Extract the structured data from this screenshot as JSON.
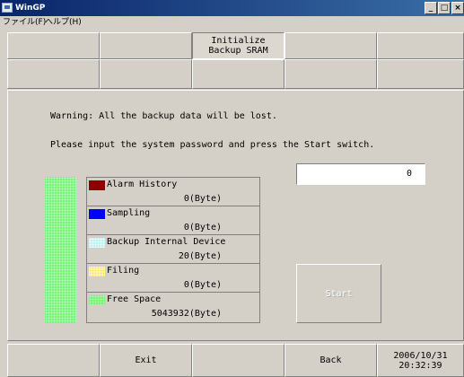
{
  "window": {
    "title": "WinGP",
    "controls": [
      "_",
      "□",
      "×"
    ]
  },
  "menu": {
    "items": [
      "ファイル(F)",
      "ヘルプ(H)"
    ]
  },
  "toolbar": {
    "row1": [
      "",
      "Initialize\nBackup SRAM",
      "",
      "",
      ""
    ],
    "row2": [
      "",
      "",
      "",
      "",
      ""
    ]
  },
  "messages": {
    "warning": "Warning: All the backup data will be lost.",
    "prompt": "Please input the system password and press the Start switch."
  },
  "password": {
    "value": "0"
  },
  "usage": {
    "free_fraction": 1.0,
    "color": "#7cf27c"
  },
  "legend": [
    {
      "name": "Alarm History",
      "value": "0(Byte)",
      "color": "#8b0000",
      "icon": "alarm-history-swatch"
    },
    {
      "name": "Sampling",
      "value": "0(Byte)",
      "color": "#0000ff",
      "icon": "sampling-swatch"
    },
    {
      "name": "Backup Internal Device",
      "value": "20(Byte)",
      "color": "#bff3f3",
      "icon": "backup-internal-device-swatch"
    },
    {
      "name": "Filing",
      "value": "0(Byte)",
      "color": "#ffff80",
      "icon": "filing-swatch"
    },
    {
      "name": "Free Space",
      "value": "5043932(Byte)",
      "color": "#7cf27c",
      "icon": "free-space-swatch"
    }
  ],
  "start_button": {
    "label": "Start",
    "enabled": false
  },
  "footer": {
    "exit_label": "Exit",
    "back_label": "Back",
    "date": "2006/10/31",
    "time": "20:32:39"
  }
}
